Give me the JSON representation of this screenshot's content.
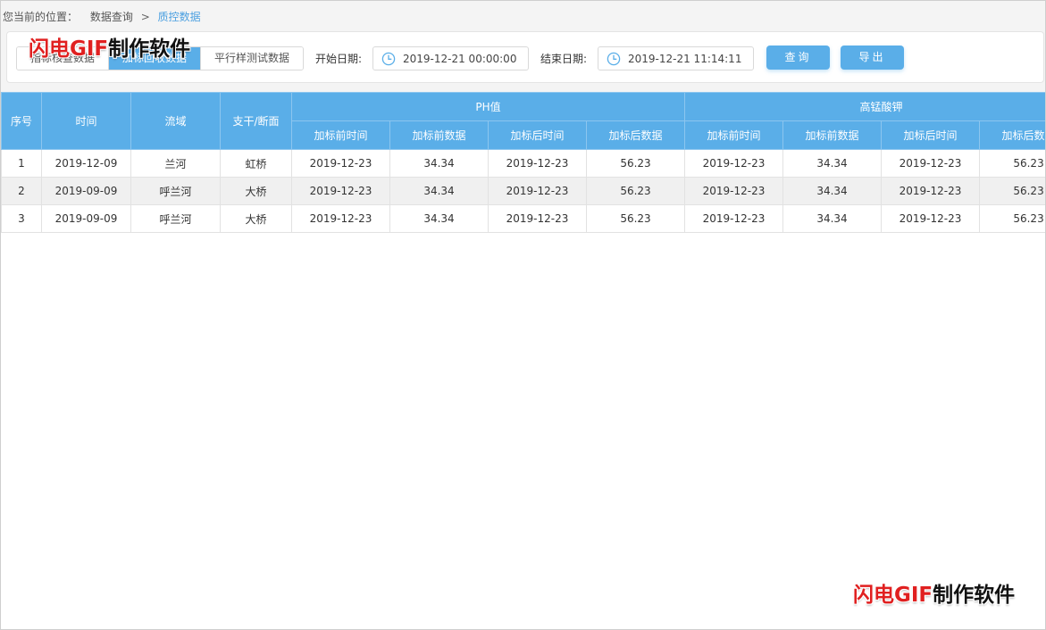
{
  "breadcrumb": {
    "prefix": "您当前的位置：",
    "level1": "数据查询",
    "sep": ">",
    "current": "质控数据"
  },
  "tabs": [
    {
      "label": "指标核查数据",
      "active": false
    },
    {
      "label": "加标回收数据",
      "active": true
    },
    {
      "label": "平行样测试数据",
      "active": false
    }
  ],
  "filters": {
    "start_label": "开始日期:",
    "start_value": "2019-12-21 00:00:00",
    "end_label": "结束日期:",
    "end_value": "2019-12-21 11:14:11"
  },
  "buttons": {
    "query": "查询",
    "export": "导出"
  },
  "table": {
    "fixed_headers": [
      "序号",
      "时间",
      "流域",
      "支干/断面"
    ],
    "groups": [
      {
        "name": "PH值",
        "sub": [
          "加标前时间",
          "加标前数据",
          "加标后时间",
          "加标后数据"
        ]
      },
      {
        "name": "高锰酸钾",
        "sub": [
          "加标前时间",
          "加标前数据",
          "加标后时间",
          "加标后数据"
        ]
      }
    ],
    "rows": [
      [
        "1",
        "2019-12-09",
        "兰河",
        "虹桥",
        "2019-12-23",
        "34.34",
        "2019-12-23",
        "56.23",
        "2019-12-23",
        "34.34",
        "2019-12-23",
        "56.23"
      ],
      [
        "2",
        "2019-09-09",
        "呼兰河",
        "大桥",
        "2019-12-23",
        "34.34",
        "2019-12-23",
        "56.23",
        "2019-12-23",
        "34.34",
        "2019-12-23",
        "56.23"
      ],
      [
        "3",
        "2019-09-09",
        "呼兰河",
        "大桥",
        "2019-12-23",
        "34.34",
        "2019-12-23",
        "56.23",
        "2019-12-23",
        "34.34",
        "2019-12-23",
        "56.23"
      ]
    ]
  },
  "watermark": {
    "part1": "闪电GIF",
    "part2": "制作软件"
  },
  "colors": {
    "accent": "#5aaee8",
    "watermark_red": "#e02020"
  }
}
